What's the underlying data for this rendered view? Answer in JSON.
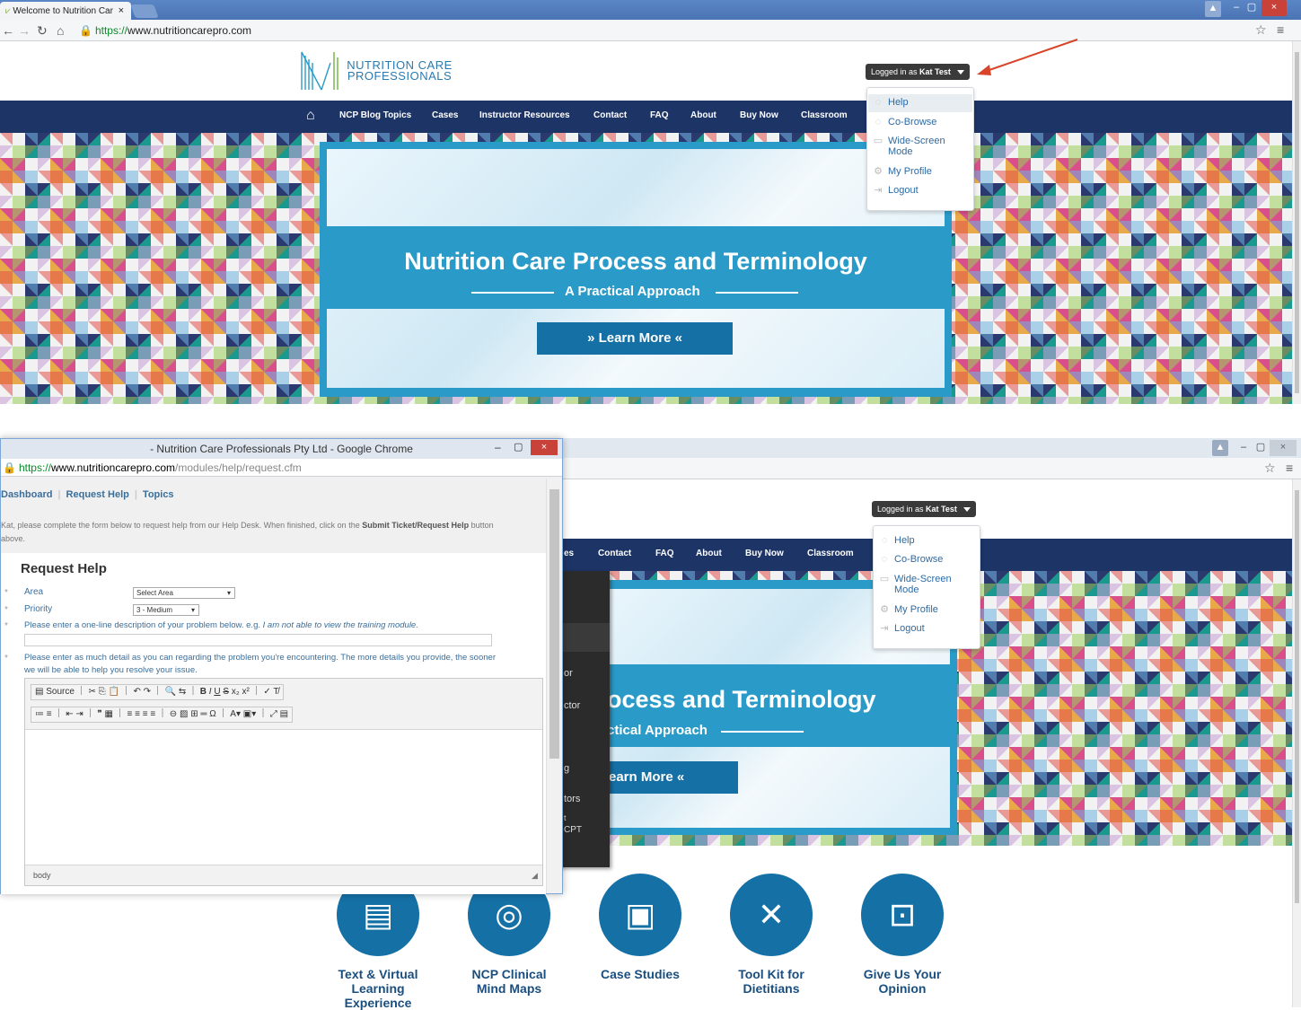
{
  "browser": {
    "tab_title": "Welcome to Nutrition Car",
    "tab_close": "×",
    "url_secure": "https://",
    "url_host": "www.nutritioncarepro.com",
    "min": "–",
    "max": "▢",
    "close": "×"
  },
  "site": {
    "logo_line1": "NUTRITION CARE",
    "logo_line2": "PROFESSIONALS",
    "logged_in_prefix": "Logged in as ",
    "logged_in_user": "Kat Test",
    "nav": [
      "NCP Blog Topics",
      "Cases",
      "Instructor Resources",
      "Contact",
      "FAQ",
      "About",
      "Buy Now",
      "Classroom"
    ],
    "dropdown": [
      "Help",
      "Co-Browse",
      "Wide-Screen Mode",
      "My Profile",
      "Logout"
    ],
    "dropdown_wide_l1": "Wide-Screen",
    "dropdown_wide_l2": "Mode",
    "hero_title": "Nutrition Care Process and Terminology",
    "hero_title_partial": "ocess and Terminology",
    "hero_sub": "A Practical Approach",
    "hero_sub_partial": "ctical Approach",
    "learn_more": "»  Learn More  «",
    "learn_more_partial": "earn More  «",
    "side_menu_partial": [
      "or",
      "ctor",
      "g",
      "tors",
      "t",
      "CPT"
    ]
  },
  "popup": {
    "window_title": "- Nutrition Care Professionals Pty Ltd - Google Chrome",
    "url_secure": "https://",
    "url_host": "www.nutritioncarepro.com",
    "url_path": "/modules/help/request.cfm",
    "tabs": [
      "Dashboard",
      "Request Help",
      "Topics"
    ],
    "intro_a": "Kat, please complete the form below to request help from our Help Desk. When finished, click on the ",
    "intro_b": "Submit Ticket/Request Help",
    "intro_c": " button",
    "intro_d": "above.",
    "heading": "Request Help",
    "area_label": "Area",
    "area_value": "Select Area",
    "priority_label": "Priority",
    "priority_value": "3 - Medium",
    "desc_label": "Please enter a one-line description of your problem below. e.g. ",
    "desc_example": "I am not able to view the training module.",
    "detail_label_1": "Please enter as much detail as you can regarding the problem you're encountering. The more details you provide, the sooner",
    "detail_label_2": "we will be able to help you resolve your issue.",
    "source_btn": "Source",
    "status": "body",
    "required": "*"
  },
  "features": [
    {
      "l1": "Text & Virtual",
      "l2": "Learning",
      "l3": "Experience",
      "icon": "document-icon"
    },
    {
      "l1": "NCP Clinical",
      "l2": "Mind Maps",
      "l3": "",
      "icon": "target-icon"
    },
    {
      "l1": "Case Studies",
      "l2": "",
      "l3": "",
      "icon": "clipboard-icon"
    },
    {
      "l1": "Tool Kit for",
      "l2": "Dietitians",
      "l3": "",
      "icon": "tools-icon"
    },
    {
      "l1": "Give Us Your",
      "l2": "Opinion",
      "l3": "",
      "icon": "briefcase-icon"
    }
  ],
  "colors": {
    "navbar": "#1d3466",
    "accent": "#2a9bc8",
    "button": "#1570a6",
    "arrow": "#d9452b"
  }
}
